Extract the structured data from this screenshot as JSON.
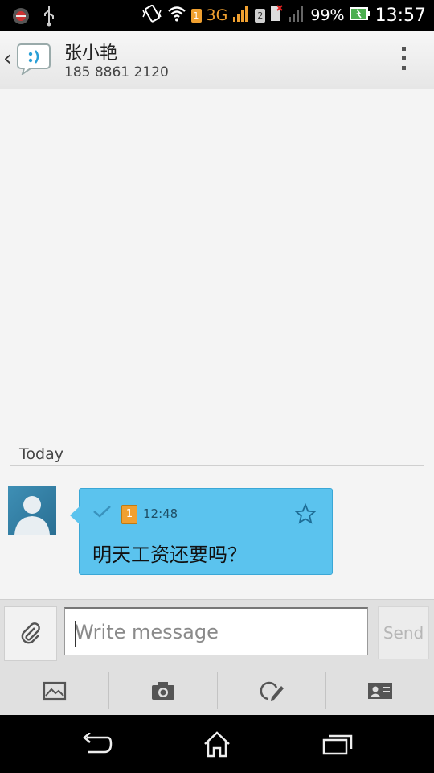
{
  "status_bar": {
    "network": "3G",
    "sim1_label": "1",
    "sim2_label": "2",
    "battery": "99%",
    "time": "13:57"
  },
  "header": {
    "contact_name": "张小艳",
    "contact_phone": "185 8861 2120"
  },
  "conversation": {
    "day_label": "Today",
    "messages": [
      {
        "sim": "1",
        "time": "12:48",
        "text": "明天工资还要吗？"
      }
    ]
  },
  "compose": {
    "placeholder": "Write message",
    "send_label": "Send"
  },
  "colors": {
    "bubble": "#5bc3ee",
    "accent": "#3aa7d6",
    "sim_badge": "#f0a030"
  }
}
